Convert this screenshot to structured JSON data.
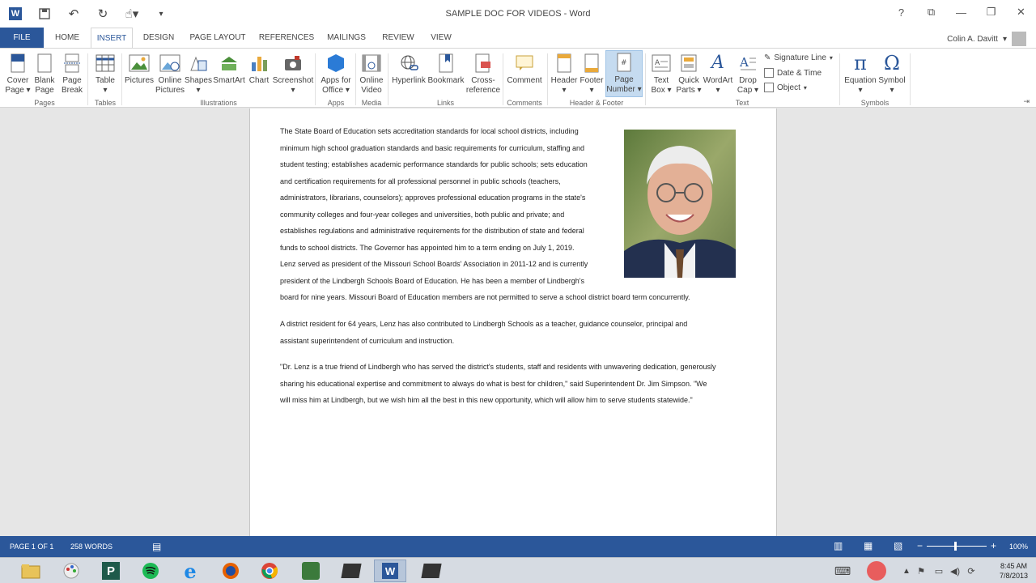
{
  "window": {
    "title": "SAMPLE DOC FOR VIDEOS - Word",
    "controls": [
      "?",
      "⧉",
      "—",
      "❐",
      "✕"
    ]
  },
  "tabs": {
    "file": "FILE",
    "items": [
      "HOME",
      "INSERT",
      "DESIGN",
      "PAGE LAYOUT",
      "REFERENCES",
      "MAILINGS",
      "REVIEW",
      "VIEW"
    ],
    "active": "INSERT"
  },
  "user": {
    "name": "Colin A. Davitt"
  },
  "ribbon": {
    "cover_page": [
      "Cover",
      "Page ▾"
    ],
    "blank_page": [
      "Blank",
      "Page"
    ],
    "page_break": [
      "Page",
      "Break"
    ],
    "table": [
      "Table",
      "▾"
    ],
    "pictures": "Pictures",
    "online_pictures": [
      "Online",
      "Pictures"
    ],
    "shapes": [
      "Shapes",
      "▾"
    ],
    "smartart": "SmartArt",
    "chart": "Chart",
    "screenshot": [
      "Screenshot",
      "▾"
    ],
    "apps_for_office": [
      "Apps for",
      "Office ▾"
    ],
    "online_video": [
      "Online",
      "Video"
    ],
    "hyperlink": "Hyperlink",
    "bookmark": "Bookmark",
    "cross_reference": [
      "Cross-",
      "reference"
    ],
    "comment": "Comment",
    "header": [
      "Header",
      "▾"
    ],
    "footer": [
      "Footer",
      "▾"
    ],
    "page_number": [
      "Page",
      "Number ▾"
    ],
    "text_box": [
      "Text",
      "Box ▾"
    ],
    "quick_parts": [
      "Quick",
      "Parts ▾"
    ],
    "wordart": [
      "WordArt",
      "▾"
    ],
    "drop_cap": [
      "Drop",
      "Cap ▾"
    ],
    "signature_line": "Signature Line",
    "date_time": "Date & Time",
    "object": "Object",
    "equation": [
      "Equation",
      "▾"
    ],
    "symbol": [
      "Symbol",
      "▾"
    ],
    "groups": {
      "pages": "Pages",
      "tables": "Tables",
      "illustrations": "Illustrations",
      "apps": "Apps",
      "media": "Media",
      "links": "Links",
      "comments": "Comments",
      "header_footer": "Header & Footer",
      "text": "Text",
      "symbols": "Symbols"
    }
  },
  "document": {
    "p1_lines": [
      "The State Board of Education sets accreditation standards for local school districts, including",
      "minimum high school graduation standards and basic requirements for curriculum, staffing and",
      "student testing; establishes academic performance standards for public schools; sets education",
      "and certification requirements for all professional personnel in public schools (teachers,",
      "administrators, librarians, counselors); approves professional education programs in the state's",
      "community colleges and four-year colleges and universities, both public and private; and",
      "establishes regulations and administrative requirements for the distribution of state and federal",
      "funds to school districts. The Governor has appointed him to a term ending on July 1, 2019.",
      "Lenz served as president of the Missouri School Boards' Association in 2011-12 and is currently",
      "president of the Lindbergh Schools Board of Education. He has been a member of Lindbergh's",
      "board for nine years. Missouri Board of Education members are not permitted to serve a school district board term concurrently."
    ],
    "p2_lines": [
      "A district resident for 64 years, Lenz has also contributed to Lindbergh Schools as a teacher, guidance counselor, principal and",
      "assistant superintendent of curriculum and instruction."
    ],
    "p3_lines": [
      "\"Dr. Lenz is a true friend of Lindbergh who has served the district's students, staff and residents with unwavering dedication, generously",
      "sharing his educational expertise and commitment to always do what is best for children,\" said Superintendent Dr. Jim Simpson. \"We",
      "will miss him at Lindbergh, but we wish him all the best in this new opportunity, which will allow him to serve students statewide.\""
    ]
  },
  "status": {
    "page": "PAGE 1 OF 1",
    "words": "258 WORDS",
    "zoom": "100%"
  },
  "clock": {
    "time": "8:45 AM",
    "date": "7/8/2013"
  },
  "colors": {
    "accent": "#2b579a",
    "ribbon_bg": "#ffffff",
    "doc_bg": "#e6e6e6"
  }
}
